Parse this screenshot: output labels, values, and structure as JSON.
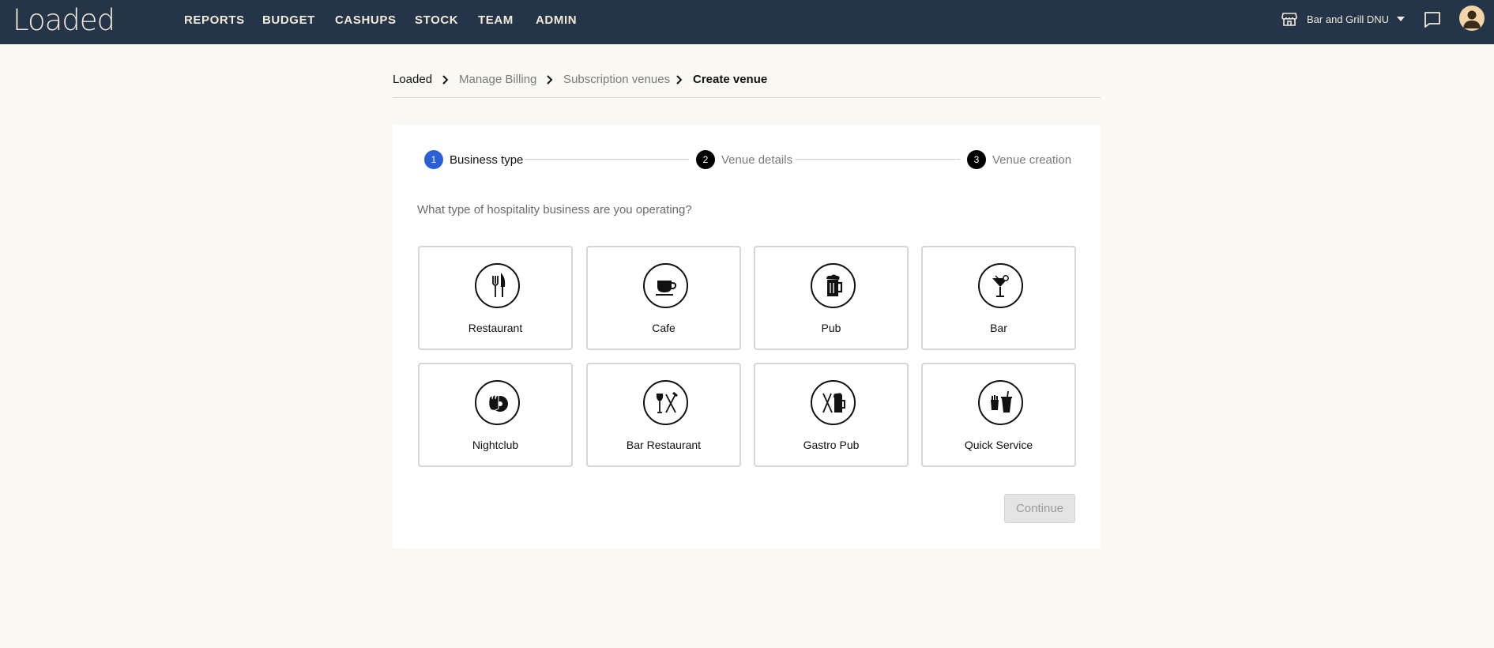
{
  "app": {
    "logo": "Loaded"
  },
  "nav": {
    "items": [
      "REPORTS",
      "BUDGET",
      "CASHUPS",
      "STOCK",
      "TEAM",
      "ADMIN"
    ]
  },
  "header": {
    "venue_name": "Bar and Grill DNU",
    "store_icon": "store-icon",
    "chat_icon": "chat-icon",
    "avatar_icon": "user-avatar-icon"
  },
  "breadcrumb": [
    "Loaded",
    "Manage Billing",
    "Subscription venues",
    "Create venue"
  ],
  "stepper": {
    "steps": [
      {
        "num": "1",
        "label": "Business type"
      },
      {
        "num": "2",
        "label": "Venue details"
      },
      {
        "num": "3",
        "label": "Venue creation"
      }
    ],
    "active_color": "#2a5fd6"
  },
  "question": "What type of hospitality business are you operating?",
  "business_types": [
    {
      "label": "Restaurant",
      "icon": "fork-knife-icon"
    },
    {
      "label": "Cafe",
      "icon": "coffee-cup-icon"
    },
    {
      "label": "Pub",
      "icon": "beer-mug-icon"
    },
    {
      "label": "Bar",
      "icon": "cocktail-glass-icon"
    },
    {
      "label": "Nightclub",
      "icon": "vinyl-hand-icon"
    },
    {
      "label": "Bar Restaurant",
      "icon": "wine-cutlery-icon"
    },
    {
      "label": "Gastro Pub",
      "icon": "cutlery-beer-icon"
    },
    {
      "label": "Quick Service",
      "icon": "fries-drink-icon"
    }
  ],
  "actions": {
    "continue_label": "Continue"
  },
  "colors": {
    "topbar": "#253549",
    "nav_text": "#f3ead8",
    "background": "#f9f8f3"
  }
}
